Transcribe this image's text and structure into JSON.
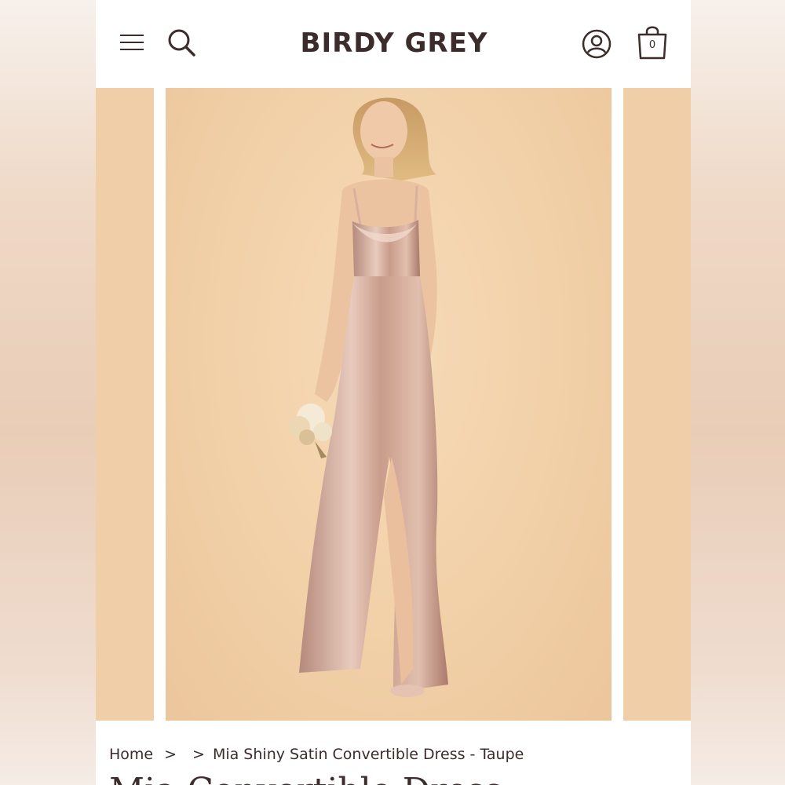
{
  "header": {
    "brand": "BIRDY GREY",
    "cart_count": "0"
  },
  "icons": {
    "menu": "hamburger-menu-icon",
    "search": "search-icon",
    "account": "account-icon",
    "cart": "shopping-bag-icon"
  },
  "gallery": {
    "image_subject": "model in taupe satin gown holding bouquet"
  },
  "breadcrumb": {
    "home": "Home",
    "sep1": ">",
    "sep2": ">",
    "current": "Mia Shiny Satin Convertible Dress - Taupe"
  },
  "product": {
    "title": "Mia Convertible Dress"
  },
  "colors": {
    "brand_text": "#3c2c2c",
    "backdrop": "#f0cfa8",
    "dress": "#c9a090"
  }
}
